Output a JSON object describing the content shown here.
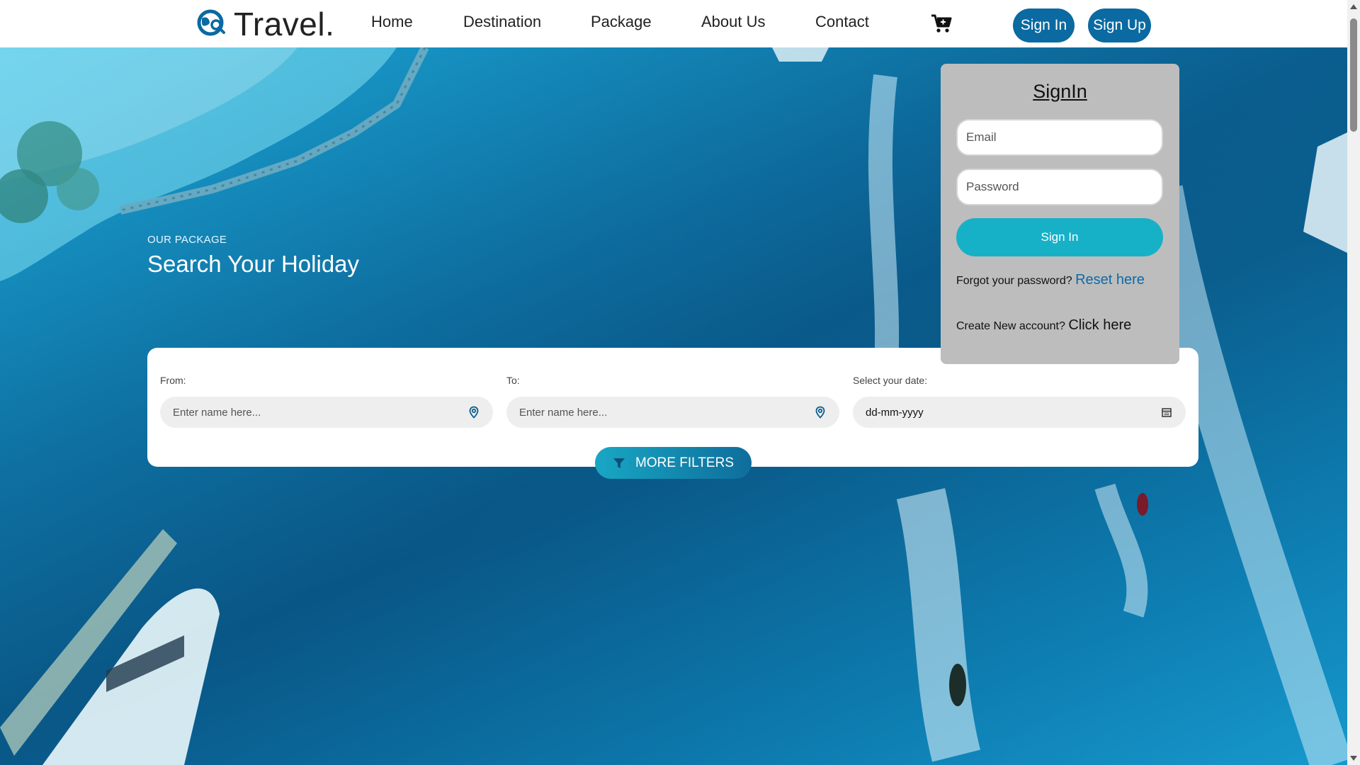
{
  "brand": {
    "name": "Travel."
  },
  "nav": [
    {
      "label": "Home"
    },
    {
      "label": "Destination"
    },
    {
      "label": "Package"
    },
    {
      "label": "About Us"
    },
    {
      "label": "Contact"
    }
  ],
  "header": {
    "cart_icon": "cart-icon",
    "signin_label": "Sign In",
    "signup_label": "Sign Up"
  },
  "hero": {
    "eyebrow": "OUR PACKAGE",
    "headline": "Search Your Holiday"
  },
  "search": {
    "from_label": "From:",
    "from_placeholder": "Enter name here...",
    "to_label": "To:",
    "to_placeholder": "Enter name here...",
    "date_label": "Select your date:",
    "date_value": "dd-mm-yyyy",
    "more_filters_label": "MORE FILTERS"
  },
  "signin_card": {
    "title": "SignIn",
    "email_placeholder": "Email",
    "password_placeholder": "Password",
    "button_label": "Sign In",
    "forgot_text": "Forgot your password?",
    "forgot_link": "Reset here",
    "create_text": "Create New account?",
    "create_link": "Click here"
  },
  "colors": {
    "primary": "#0a6aa1",
    "accent": "#17b1c7",
    "card_bg": "#bdbdbd"
  }
}
